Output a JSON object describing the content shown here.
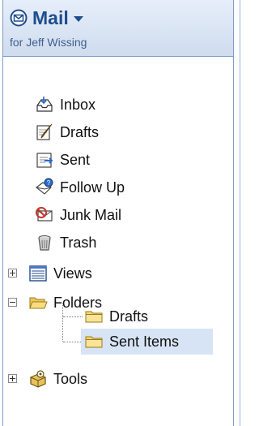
{
  "window": {
    "title": "Mail",
    "subtitle": "for Jeff Wissing"
  },
  "nav": {
    "items": [
      {
        "label": "Inbox",
        "icon": "inbox-icon"
      },
      {
        "label": "Drafts",
        "icon": "drafts-icon"
      },
      {
        "label": "Sent",
        "icon": "sent-icon"
      },
      {
        "label": "Follow Up",
        "icon": "follow-up-icon"
      },
      {
        "label": "Junk Mail",
        "icon": "junk-mail-icon"
      },
      {
        "label": "Trash",
        "icon": "trash-icon"
      },
      {
        "label": "Views",
        "icon": "views-icon",
        "expander": "plus"
      },
      {
        "label": "Folders",
        "icon": "folder-open-icon",
        "expander": "minus",
        "children": [
          {
            "label": "Drafts",
            "icon": "folder-icon"
          },
          {
            "label": "Sent Items",
            "icon": "folder-icon",
            "selected": true
          }
        ]
      },
      {
        "label": "Tools",
        "icon": "tools-icon",
        "expander": "plus"
      }
    ]
  },
  "colors": {
    "header_text": "#1f4d8e",
    "selection": "#d7e4f5",
    "border": "#7e9cc4"
  }
}
